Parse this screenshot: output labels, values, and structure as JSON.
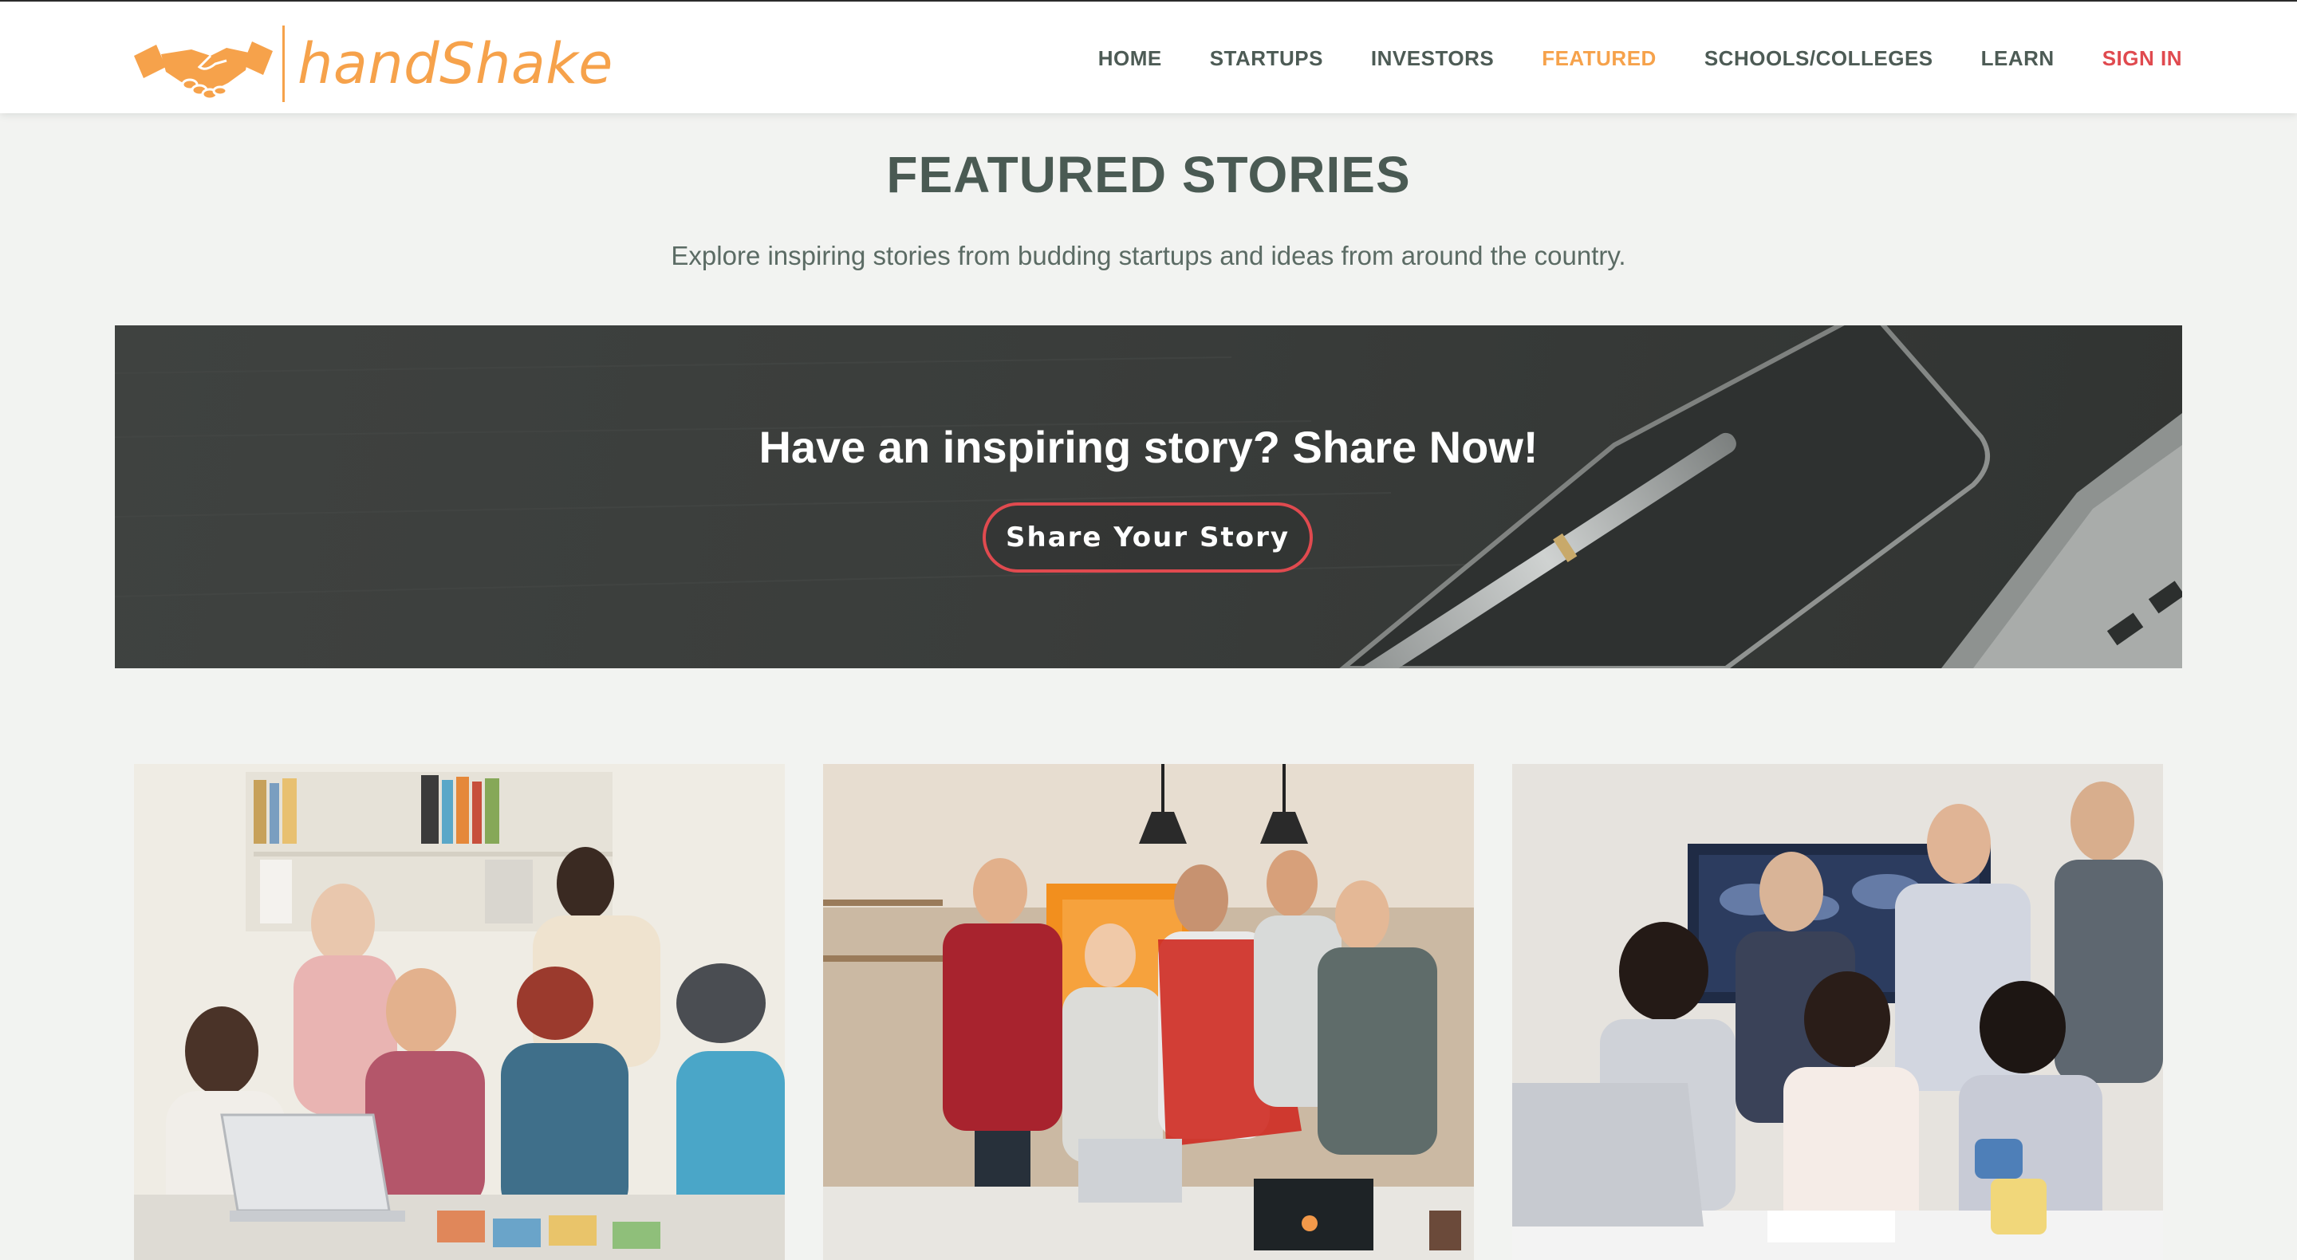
{
  "brand": {
    "name": "handShake",
    "accent": "#f6a24b"
  },
  "nav": {
    "items": [
      {
        "label": "HOME",
        "state": "default"
      },
      {
        "label": "STARTUPS",
        "state": "default"
      },
      {
        "label": "INVESTORS",
        "state": "default"
      },
      {
        "label": "FEATURED",
        "state": "active"
      },
      {
        "label": "SCHOOLS/COLLEGES",
        "state": "default"
      },
      {
        "label": "LEARN",
        "state": "default"
      },
      {
        "label": "SIGN IN",
        "state": "signin"
      }
    ],
    "active_color": "#f6a24b",
    "signin_color": "#e04a4f"
  },
  "header": {
    "title": "FEATURED STORIES",
    "subtitle": "Explore inspiring stories from budding startups and ideas from around the country."
  },
  "banner": {
    "title": "Have an inspiring story? Share Now!",
    "button_label": "Share Your Story",
    "button_border_color": "#e04a4f"
  },
  "stories": [
    {
      "image": "team-around-laptop-photo"
    },
    {
      "image": "startup-team-standing-photo"
    },
    {
      "image": "business-team-analysis-photo"
    }
  ]
}
